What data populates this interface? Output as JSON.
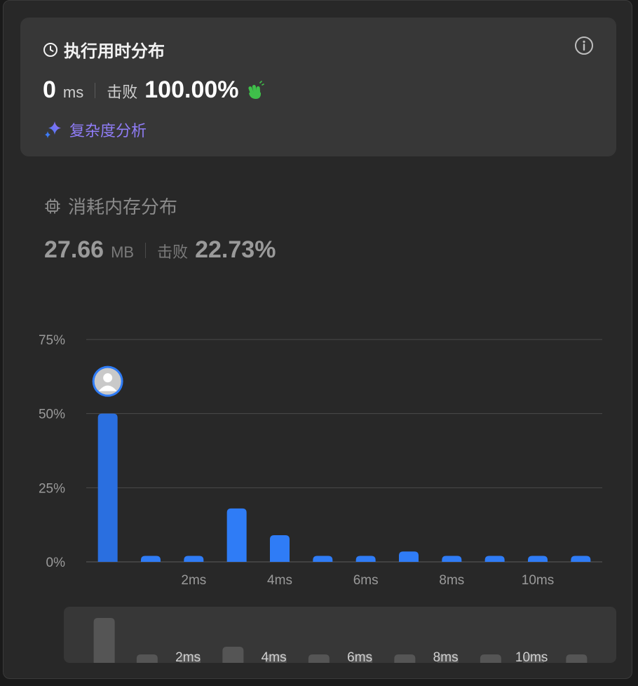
{
  "runtime": {
    "title": "执行用时分布",
    "value": "0",
    "unit": "ms",
    "beats_label": "击败",
    "beats_pct": "100.00%",
    "complexity_link": "复杂度分析"
  },
  "memory": {
    "title": "消耗内存分布",
    "value": "27.66",
    "unit": "MB",
    "beats_label": "击败",
    "beats_pct": "22.73%"
  },
  "colors": {
    "bar": "#2f7cf6",
    "bar_current": "#2a6fe0",
    "mini_bar": "#555555",
    "grid": "#4a4a4a",
    "accent_purple": "#8f7cf5",
    "clap_green": "#3fbf4a"
  },
  "icons": [
    "clock-icon",
    "info-icon",
    "clap-icon",
    "sparkle-icon",
    "chip-icon",
    "avatar"
  ],
  "chart_data": {
    "type": "bar",
    "categories": [
      "0ms",
      "1ms",
      "2ms",
      "3ms",
      "4ms",
      "5ms",
      "6ms",
      "7ms",
      "8ms",
      "9ms",
      "10ms",
      "11ms"
    ],
    "values": [
      50,
      2,
      2,
      18,
      9,
      2,
      2,
      3.5,
      2,
      2,
      2,
      2
    ],
    "current_index": 0,
    "y_ticks": [
      "0%",
      "25%",
      "50%",
      "75%"
    ],
    "y_tick_values": [
      0,
      25,
      50,
      75
    ],
    "x_tick_labels": [
      "2ms",
      "4ms",
      "6ms",
      "8ms",
      "10ms"
    ],
    "x_tick_indices": [
      2,
      4,
      6,
      8,
      10
    ],
    "ylim": [
      0,
      75
    ],
    "grid": true
  }
}
